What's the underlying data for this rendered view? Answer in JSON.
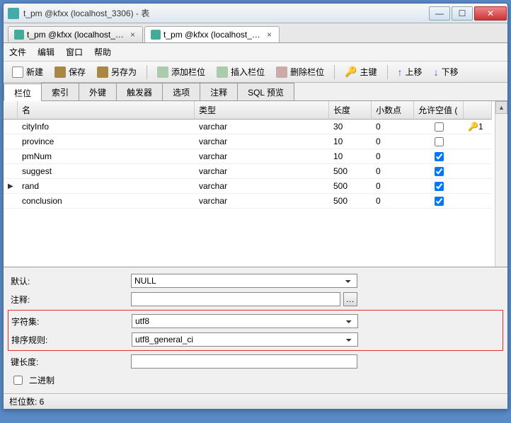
{
  "window": {
    "title": "t_pm @kfxx (localhost_3306) - 表"
  },
  "tabs": [
    {
      "label": "t_pm @kfxx (localhost_3...",
      "active": false
    },
    {
      "label": "t_pm @kfxx (localhost_3...",
      "active": true
    }
  ],
  "menu": {
    "file": "文件",
    "edit": "编辑",
    "window": "窗口",
    "help": "帮助"
  },
  "toolbar": {
    "new": "新建",
    "save": "保存",
    "saveas": "另存为",
    "addcol": "添加栏位",
    "inscol": "插入栏位",
    "delcol": "删除栏位",
    "pk": "主键",
    "up": "上移",
    "down": "下移"
  },
  "subtabs": {
    "columns": "栏位",
    "indexes": "索引",
    "fk": "外键",
    "triggers": "触发器",
    "options": "选项",
    "comment": "注释",
    "sql": "SQL 预览"
  },
  "columns_header": {
    "name": "名",
    "type": "类型",
    "length": "长度",
    "decimals": "小数点",
    "nullable": "允许空值 (",
    "key": ""
  },
  "rows": [
    {
      "name": "cityInfo",
      "type": "varchar",
      "length": "30",
      "decimals": "0",
      "nullable": false,
      "key": "1",
      "current": false
    },
    {
      "name": "province",
      "type": "varchar",
      "length": "10",
      "decimals": "0",
      "nullable": false,
      "key": "",
      "current": false
    },
    {
      "name": "pmNum",
      "type": "varchar",
      "length": "10",
      "decimals": "0",
      "nullable": true,
      "key": "",
      "current": false
    },
    {
      "name": "suggest",
      "type": "varchar",
      "length": "500",
      "decimals": "0",
      "nullable": true,
      "key": "",
      "current": false
    },
    {
      "name": "rand",
      "type": "varchar",
      "length": "500",
      "decimals": "0",
      "nullable": true,
      "key": "",
      "current": true
    },
    {
      "name": "conclusion",
      "type": "varchar",
      "length": "500",
      "decimals": "0",
      "nullable": true,
      "key": "",
      "current": false
    }
  ],
  "props": {
    "default_label": "默认:",
    "default_value": "NULL",
    "comment_label": "注释:",
    "comment_value": "",
    "charset_label": "字符集:",
    "charset_value": "utf8",
    "collation_label": "排序规则:",
    "collation_value": "utf8_general_ci",
    "keylen_label": "键长度:",
    "keylen_value": "",
    "binary_label": "二进制"
  },
  "status": {
    "text": "栏位数: 6"
  }
}
